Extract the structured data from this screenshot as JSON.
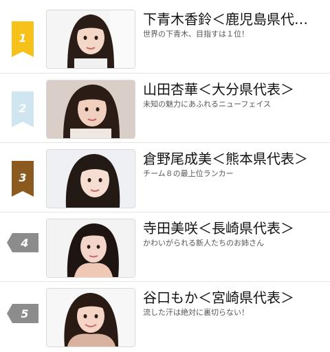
{
  "ranking": [
    {
      "rank": "1",
      "badge_color": "#f6c21a",
      "name": "下青木香鈴＜鹿児島県代…",
      "catchphrase": "世界の下青木、目指すは１位！"
    },
    {
      "rank": "2",
      "badge_color": "#cfe5ef",
      "name": "山田杏華＜大分県代表＞",
      "catchphrase": "未知の魅力にあふれるニューフェイス"
    },
    {
      "rank": "3",
      "badge_color": "#8a5a1f",
      "name": "倉野尾成美＜熊本県代表＞",
      "catchphrase": "チーム８の最上位ランカー"
    },
    {
      "rank": "4",
      "badge_color": "#8c8c8c",
      "name": "寺田美咲＜長崎県代表＞",
      "catchphrase": "かわいがられる新人たちのお姉さん"
    },
    {
      "rank": "5",
      "badge_color": "#8c8c8c",
      "name": "谷口もか＜宮崎県代表＞",
      "catchphrase": "流した汗は絶対に裏切らない！"
    }
  ]
}
